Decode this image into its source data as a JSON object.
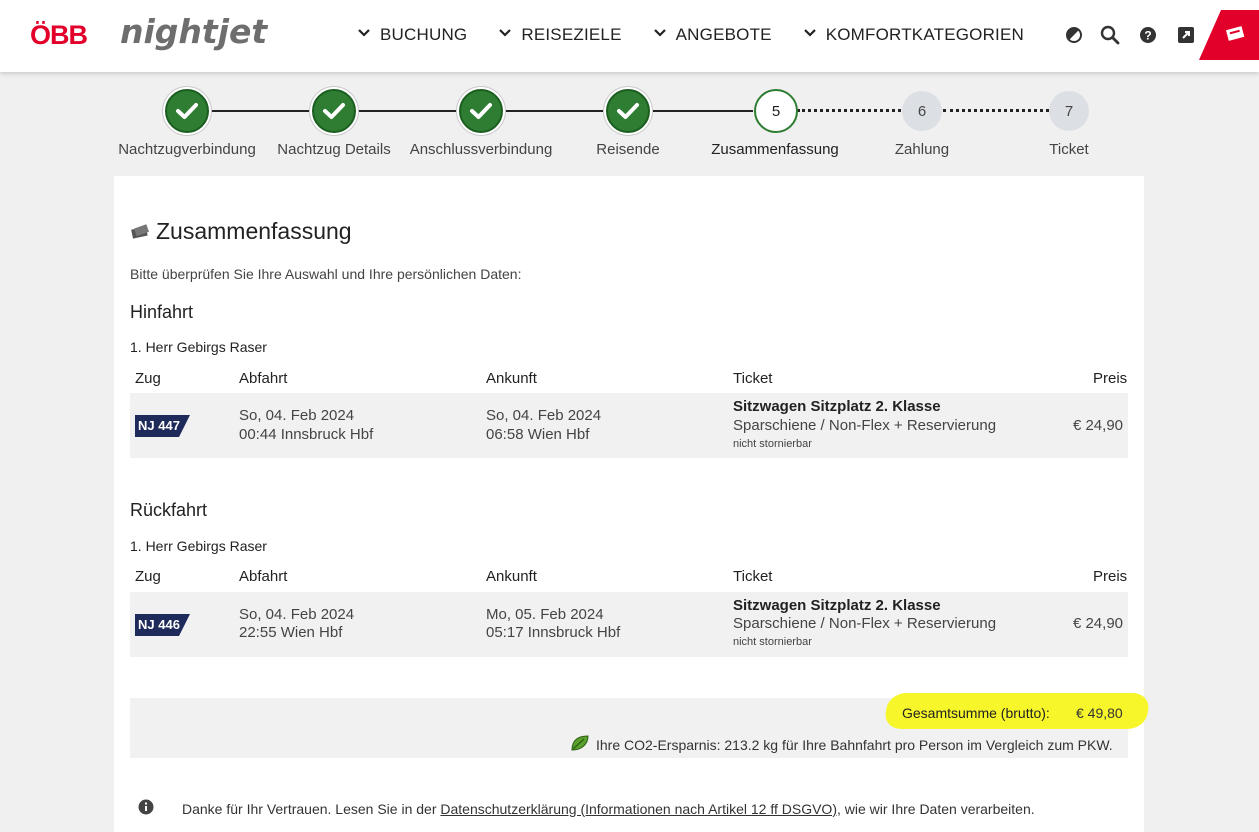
{
  "header": {
    "logo_obb": "ÖBB",
    "logo_nightjet": "nightjet",
    "nav": [
      {
        "label": "BUCHUNG"
      },
      {
        "label": "REISEZIELE"
      },
      {
        "label": "ANGEBOTE"
      },
      {
        "label": "KOMFORTKATEGORIEN"
      }
    ],
    "icons": [
      "contrast-icon",
      "search-icon",
      "help-icon",
      "external-link-icon",
      "ticket-icon"
    ],
    "accent_color": "#e2002a"
  },
  "stepper": {
    "steps": [
      {
        "num": "1",
        "label": "Nachtzugverbindung",
        "state": "done"
      },
      {
        "num": "2",
        "label": "Nachtzug Details",
        "state": "done"
      },
      {
        "num": "3",
        "label": "Anschlussverbindung",
        "state": "done"
      },
      {
        "num": "4",
        "label": "Reisende",
        "state": "done"
      },
      {
        "num": "5",
        "label": "Zusammenfassung",
        "state": "current"
      },
      {
        "num": "6",
        "label": "Zahlung",
        "state": "todo"
      },
      {
        "num": "7",
        "label": "Ticket",
        "state": "todo"
      }
    ],
    "done_color": "#2e7d32"
  },
  "summary": {
    "title": "Zusammenfassung",
    "intro": "Bitte überprüfen Sie Ihre Auswahl und Ihre persönlichen Daten:",
    "columns": {
      "zug": "Zug",
      "abfahrt": "Abfahrt",
      "ankunft": "Ankunft",
      "ticket": "Ticket",
      "preis": "Preis"
    },
    "outbound": {
      "heading": "Hinfahrt",
      "passenger": "1. Herr Gebirgs Raser",
      "train": "NJ 447",
      "dep_date": "So, 04. Feb 2024",
      "dep_time_station": "00:44 Innsbruck Hbf",
      "arr_date": "So, 04. Feb 2024",
      "arr_time_station": "06:58 Wien Hbf",
      "ticket_main": "Sitzwagen Sitzplatz 2. Klasse",
      "ticket_sub": "Sparschiene / Non-Flex + Reservierung",
      "ticket_note": "nicht stornierbar",
      "price": "€ 24,90"
    },
    "return": {
      "heading": "Rückfahrt",
      "passenger": "1. Herr Gebirgs Raser",
      "train": "NJ 446",
      "dep_date": "So, 04. Feb 2024",
      "dep_time_station": "22:55 Wien Hbf",
      "arr_date": "Mo, 05. Feb 2024",
      "arr_time_station": "05:17 Innsbruck Hbf",
      "ticket_main": "Sitzwagen Sitzplatz 2. Klasse",
      "ticket_sub": "Sparschiene / Non-Flex + Reservierung",
      "ticket_note": "nicht stornierbar",
      "price": "€ 24,90"
    },
    "total_label": "Gesamtsumme (brutto):",
    "total_value": "€ 49,80",
    "co2": "Ihre CO2-Ersparnis: 213.2 kg für Ihre Bahnfahrt pro Person im Vergleich zum PKW.",
    "info_pre": "Danke für Ihr Vertrauen. Lesen Sie in der",
    "info_link": "Datenschutzerklärung (Informationen nach Artikel 12 ff DSGVO)",
    "info_post": ", wie wir Ihre Daten verarbeiten.",
    "badge_color": "#1e2a5a",
    "highlight_color": "#f6f62a"
  }
}
